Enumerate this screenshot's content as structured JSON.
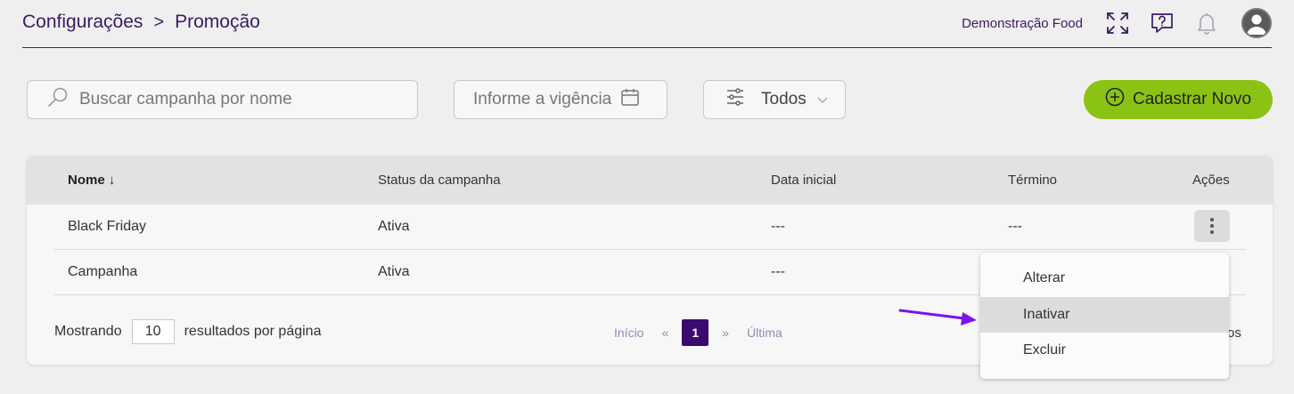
{
  "header": {
    "breadcrumb": [
      "Configurações",
      "Promoção"
    ],
    "separator": ">",
    "company": "Demonstração Food",
    "icons": [
      "fullscreen-icon",
      "help-chat-icon",
      "bell-icon",
      "user-avatar-icon"
    ]
  },
  "toolbar": {
    "search_placeholder": "Buscar campanha por nome",
    "date_placeholder": "Informe a vigência",
    "filter_label": "Todos",
    "new_button": "Cadastrar Novo"
  },
  "table": {
    "columns": [
      "Nome",
      "Status da campanha",
      "Data inicial",
      "Término",
      "Ações"
    ],
    "sort_indicator": "↓",
    "rows": [
      {
        "nome": "Black Friday",
        "status": "Ativa",
        "inicio": "---",
        "termino": "---"
      },
      {
        "nome": "Campanha",
        "status": "Ativa",
        "inicio": "---",
        "termino": ""
      }
    ]
  },
  "footer": {
    "showing": "Mostrando",
    "page_size": "10",
    "per_page": "resultados por página",
    "first": "Início",
    "prev": "«",
    "current_page": "1",
    "next": "»",
    "last": "Última",
    "right_fragment": "os"
  },
  "actions_menu": {
    "items": [
      "Alterar",
      "Inativar",
      "Excluir"
    ],
    "highlighted": "Inativar"
  },
  "colors": {
    "brand": "#3b1a63",
    "accent_green": "#8bc314",
    "pager_active": "#3b0a6e",
    "annotation_arrow": "#7b14e8"
  }
}
